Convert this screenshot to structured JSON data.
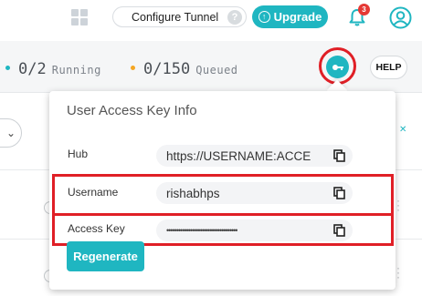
{
  "header": {
    "configure_tunnel_label": "Configure Tunnel",
    "help_badge": "?",
    "upgrade_label": "Upgrade",
    "notification_count": "3"
  },
  "status": {
    "running": {
      "value": "0/2",
      "label": "Running",
      "color": "#1fb6c1"
    },
    "queued": {
      "value": "0/150",
      "label": "Queued",
      "color": "#f5a623"
    },
    "help_label": "HELP"
  },
  "popover": {
    "title": "User Access Key Info",
    "hub": {
      "label": "Hub",
      "value": "https://USERNAME:ACCE"
    },
    "username": {
      "label": "Username",
      "value": "rishabhps"
    },
    "access_key": {
      "label": "Access Key",
      "value": "••••••••••••••••••••••••••••••••••••"
    },
    "regenerate_label": "Regenerate"
  },
  "colors": {
    "accent": "#1fb6c1",
    "highlight": "#e01f26"
  }
}
